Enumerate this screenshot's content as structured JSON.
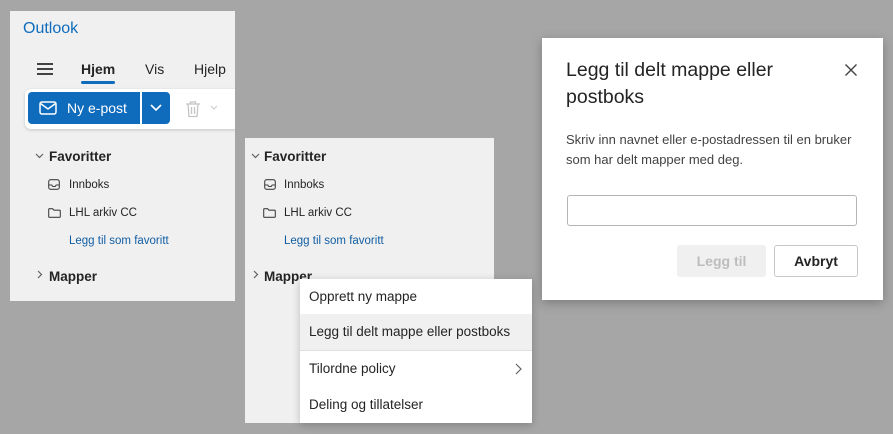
{
  "app": {
    "title": "Outlook"
  },
  "ribbon": {
    "tabs": [
      {
        "label": "Hjem",
        "active": true
      },
      {
        "label": "Vis",
        "active": false
      },
      {
        "label": "Hjelp",
        "active": false
      }
    ],
    "new_mail_label": "Ny e-post"
  },
  "nav": {
    "favorites_label": "Favoritter",
    "inbox_label": "Innboks",
    "archive_label": "LHL arkiv CC",
    "add_favorite_label": "Legg til som favoritt",
    "folders_label": "Mapper"
  },
  "context_menu": {
    "items": [
      {
        "label": "Opprett ny mappe"
      },
      {
        "label": "Legg til delt mappe eller postboks"
      },
      {
        "label": "Tilordne policy"
      },
      {
        "label": "Deling og tillatelser"
      }
    ]
  },
  "dialog": {
    "title": "Legg til delt mappe eller postboks",
    "body": "Skriv inn navnet eller e-postadressen til en bruker som har delt mapper med deg.",
    "input_value": "",
    "add_label": "Legg til",
    "cancel_label": "Avbryt"
  },
  "colors": {
    "accent": "#0f6cbd",
    "link": "#115ea3",
    "backdrop": "#a6a6a6"
  },
  "icons": [
    "menu-icon",
    "mail-icon",
    "chevron-down-icon",
    "trash-icon",
    "inbox-icon",
    "folder-icon",
    "chevron-right-icon",
    "close-icon"
  ]
}
